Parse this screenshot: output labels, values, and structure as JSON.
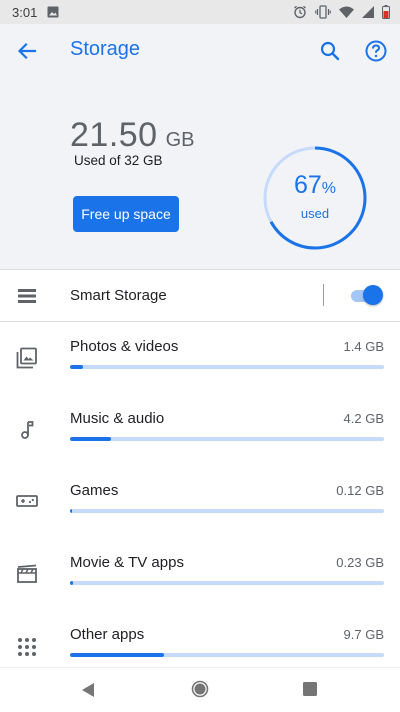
{
  "status_bar": {
    "time": "3:01",
    "icons": [
      "image-icon",
      "alarm-icon",
      "vibrate-icon",
      "wifi-icon",
      "signal-icon",
      "battery-icon"
    ]
  },
  "app_bar": {
    "title": "Storage",
    "icons": [
      "back-arrow-icon",
      "search-icon",
      "help-icon"
    ]
  },
  "summary": {
    "used_value": "21.50",
    "used_unit": "GB",
    "used_of": "Used of 32 GB",
    "free_up_button": "Free up space",
    "gauge_percent": "67",
    "gauge_percent_sign": "%",
    "gauge_used_label": "used",
    "gauge_fraction": 0.67
  },
  "smart_storage": {
    "label": "Smart Storage",
    "enabled": true,
    "icon": "smart-storage-icon"
  },
  "categories": [
    {
      "label": "Photos & videos",
      "size": "1.4 GB",
      "fraction": 0.04,
      "icon": "photos-icon"
    },
    {
      "label": "Music & audio",
      "size": "4.2 GB",
      "fraction": 0.13,
      "icon": "music-note-icon"
    },
    {
      "label": "Games",
      "size": "0.12 GB",
      "fraction": 0.005,
      "icon": "gamepad-icon"
    },
    {
      "label": "Movie & TV apps",
      "size": "0.23 GB",
      "fraction": 0.008,
      "icon": "movie-icon"
    },
    {
      "label": "Other apps",
      "size": "9.7 GB",
      "fraction": 0.3,
      "icon": "apps-grid-icon"
    }
  ],
  "colors": {
    "accent": "#1a73e8",
    "bar_track": "#c6dafc",
    "header_bg": "#f2f3f7",
    "gauge_track": "#c6dafc"
  },
  "nav_bar": {
    "icons": [
      "nav-back-icon",
      "nav-home-icon",
      "nav-recents-icon"
    ]
  }
}
